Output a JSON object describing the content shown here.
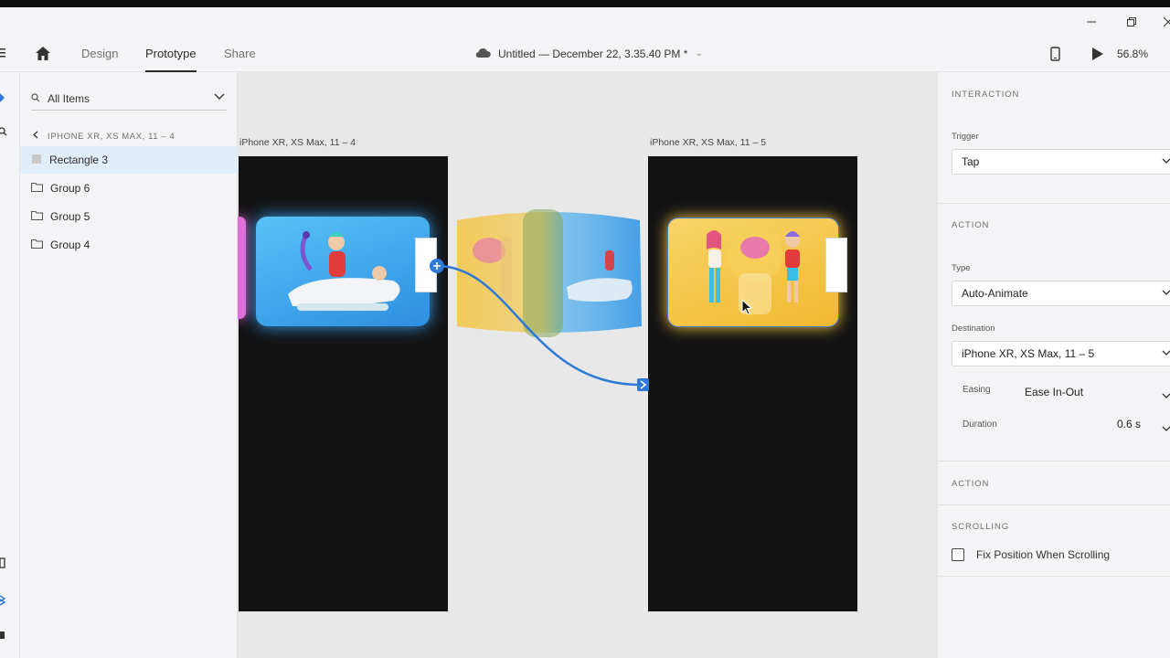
{
  "window": {
    "minimize_icon": "minimize-icon",
    "restore_icon": "restore-icon",
    "close_icon": "close-icon"
  },
  "nav": {
    "home_icon": "home-icon",
    "tabs": [
      {
        "label": "Design"
      },
      {
        "label": "Prototype"
      },
      {
        "label": "Share"
      }
    ],
    "doc_title": "Untitled — December 22, 3.35.40 PM *",
    "device_icon": "phone-icon",
    "play_icon": "play-icon",
    "zoom": "56.8%"
  },
  "layers": {
    "search_label": "All Items",
    "breadcrumb": "IPHONE XR, XS MAX, 11 – 4",
    "items": [
      {
        "label": "Rectangle 3",
        "icon": "rectangle-icon"
      },
      {
        "label": "Group 6",
        "icon": "folder-icon"
      },
      {
        "label": "Group 5",
        "icon": "folder-icon"
      },
      {
        "label": "Group 4",
        "icon": "folder-icon"
      }
    ]
  },
  "canvas": {
    "artboard_left_label": "iPhone XR, XS Max, 11 – 4",
    "artboard_right_label": "iPhone XR, XS Max, 11 – 5",
    "colors": {
      "blue": "#2e7ad6",
      "yellow": "#f4c542",
      "card_blue": "#4fb3f0",
      "pink": "#e36fd8"
    }
  },
  "interaction": {
    "title": "INTERACTION",
    "trigger_label": "Trigger",
    "trigger_value": "Tap",
    "action_title": "ACTION",
    "type_label": "Type",
    "type_value": "Auto-Animate",
    "destination_label": "Destination",
    "destination_value": "iPhone XR, XS Max, 11 – 5",
    "easing_label": "Easing",
    "easing_value": "Ease In-Out",
    "duration_label": "Duration",
    "duration_value": "0.6 s",
    "action2_title": "ACTION",
    "scrolling_title": "SCROLLING",
    "fix_position_label": "Fix Position When Scrolling"
  }
}
